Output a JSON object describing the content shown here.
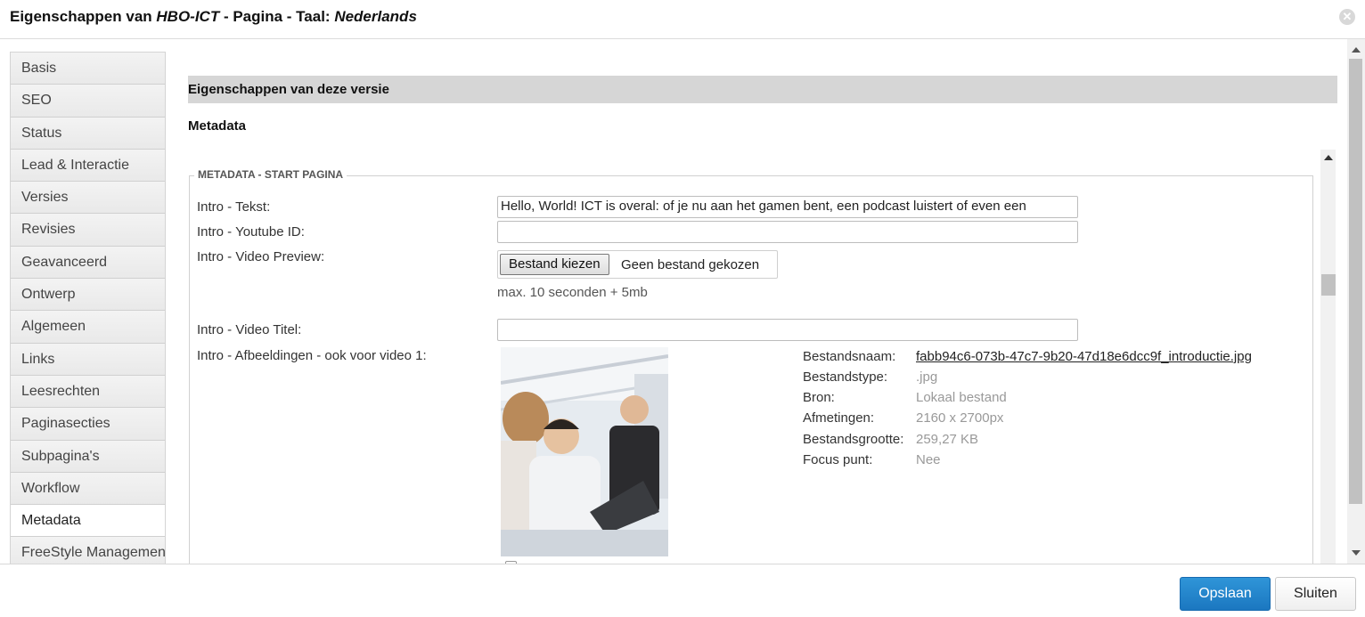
{
  "window": {
    "title_prefix": "Eigenschappen van ",
    "title_name": "HBO-ICT",
    "title_middle": " - Pagina - Taal: ",
    "title_language": "Nederlands"
  },
  "sidebar": {
    "items": [
      {
        "label": "Basis"
      },
      {
        "label": "SEO"
      },
      {
        "label": "Status"
      },
      {
        "label": "Lead & Interactie"
      },
      {
        "label": "Versies"
      },
      {
        "label": "Revisies"
      },
      {
        "label": "Geavanceerd"
      },
      {
        "label": "Ontwerp"
      },
      {
        "label": "Algemeen"
      },
      {
        "label": "Links"
      },
      {
        "label": "Leesrechten"
      },
      {
        "label": "Paginasecties"
      },
      {
        "label": "Subpagina's"
      },
      {
        "label": "Workflow"
      },
      {
        "label": "Metadata",
        "active": true
      },
      {
        "label": "FreeStyle Managemen"
      }
    ]
  },
  "main": {
    "section_header": "Eigenschappen van deze versie",
    "sub_header": "Metadata",
    "fieldset_legend": "METADATA - START PAGINA",
    "fields": {
      "intro_tekst_label": "Intro - Tekst:",
      "intro_tekst_value": "Hello, World! ICT is overal: of je nu aan het gamen bent, een podcast luistert of even een",
      "youtube_label": "Intro - Youtube ID:",
      "youtube_value": "",
      "video_preview_label": "Intro - Video Preview:",
      "file_button": "Bestand kiezen",
      "file_status": "Geen bestand gekozen",
      "file_hint": "max. 10 seconden + 5mb",
      "video_titel_label": "Intro - Video Titel:",
      "video_titel_value": "",
      "afbeeldingen_label": "Intro - Afbeeldingen - ook voor video 1:"
    },
    "image_meta": {
      "filename_key": "Bestandsnaam:",
      "filename_val": "fabb94c6-073b-47c7-9b20-47d18e6dcc9f_introductie.jpg",
      "type_key": "Bestandstype:",
      "type_val": ".jpg",
      "source_key": "Bron:",
      "source_val": "Lokaal bestand",
      "dims_key": "Afmetingen:",
      "dims_val": "2160 x 2700px",
      "size_key": "Bestandsgrootte:",
      "size_val": "259,27 KB",
      "focus_key": "Focus punt:",
      "focus_val": "Nee"
    }
  },
  "footer": {
    "save_label": "Opslaan",
    "close_label": "Sluiten"
  },
  "colors": {
    "primary_button": "#1b77c0",
    "section_header_bg": "#d6d6d6"
  }
}
